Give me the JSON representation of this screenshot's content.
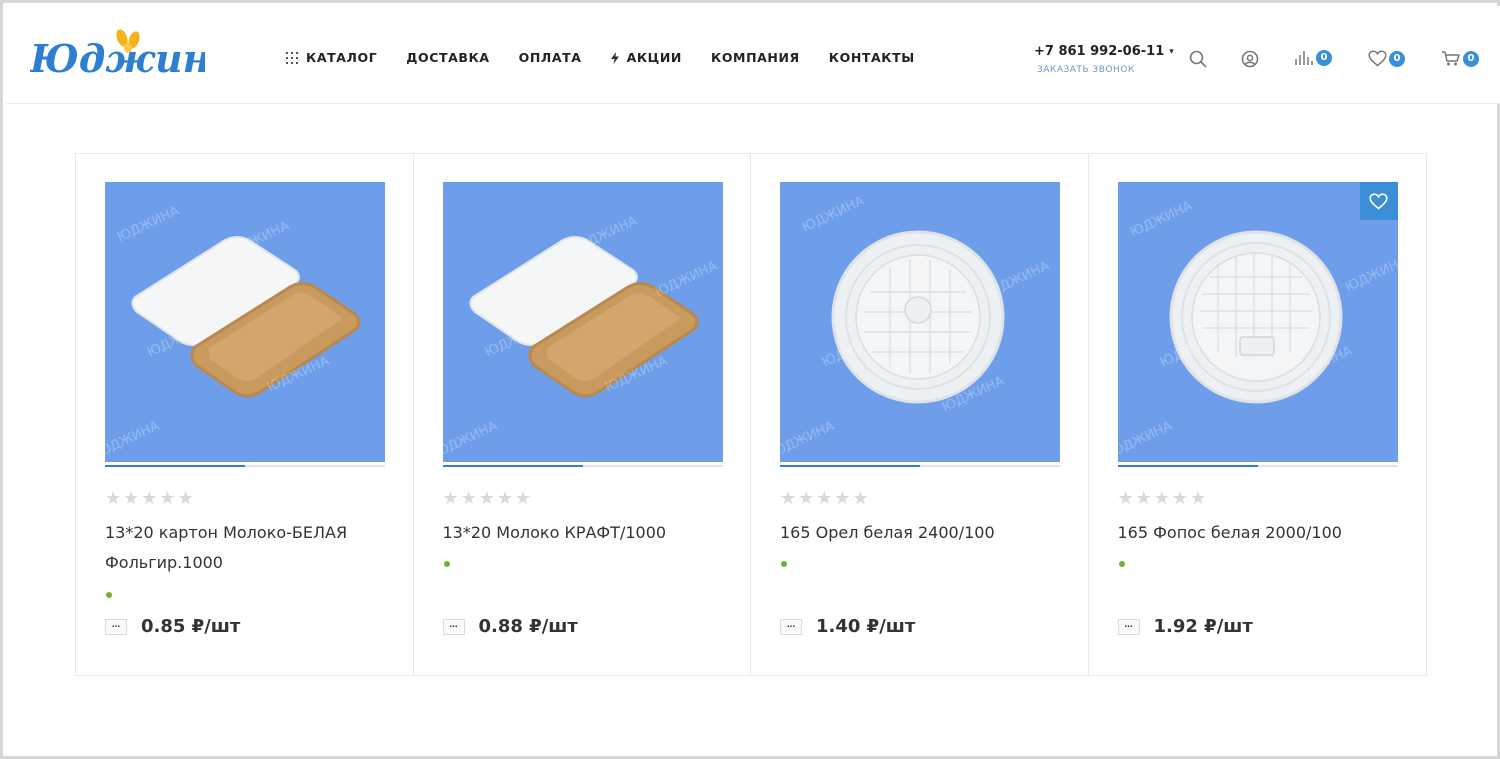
{
  "header": {
    "logo_text": "Юджина",
    "nav": [
      {
        "label": "КАТАЛОГ",
        "icon": "grid-icon"
      },
      {
        "label": "ДОСТАВКА"
      },
      {
        "label": "ОПЛАТА"
      },
      {
        "label": "АКЦИИ",
        "icon": "lightning-icon"
      },
      {
        "label": "КОМПАНИЯ"
      },
      {
        "label": "КОНТАКТЫ"
      }
    ],
    "phone": "+7 861 992-06-11",
    "callback": "ЗАКАЗАТЬ ЗВОНОК",
    "compare_count": "0",
    "favorites_count": "0",
    "cart_count": "0"
  },
  "colors": {
    "accent": "#3b8fd6",
    "image_bg": "#6e9eea",
    "in_stock_dot": "#6ab529",
    "star_empty": "#d9d9d9"
  },
  "products": [
    {
      "name": "13*20 картон Молоко-БЕЛАЯ Фольгир.1000",
      "price": "0.85 ₽/шт",
      "qty_label": "...",
      "rating": 0,
      "image": "tray-pair-image",
      "slide_progress": 0.5
    },
    {
      "name": "13*20 Молоко КРАФТ/1000",
      "price": "0.88 ₽/шт",
      "qty_label": "...",
      "rating": 0,
      "image": "tray-pair-image",
      "slide_progress": 0.5
    },
    {
      "name": "165 Орел белая 2400/100",
      "price": "1.40 ₽/шт",
      "qty_label": "...",
      "rating": 0,
      "image": "plate-image",
      "slide_progress": 0.5
    },
    {
      "name": "165 Фопос белая 2000/100",
      "price": "1.92 ₽/шт",
      "qty_label": "...",
      "rating": 0,
      "image": "plate-image",
      "slide_progress": 0.5
    }
  ],
  "watermark": "ЮДЖИНА"
}
